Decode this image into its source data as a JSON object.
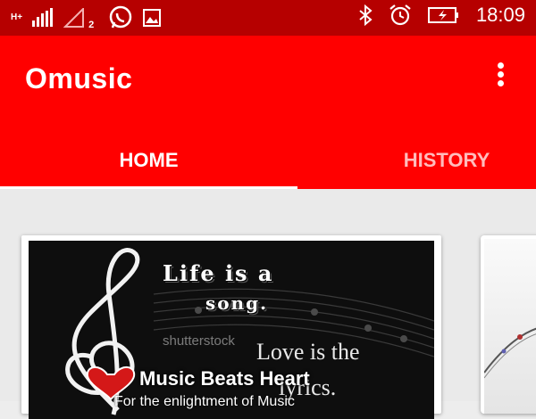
{
  "status_bar": {
    "network_type": "H+",
    "sim2_label": "2",
    "time": "18:09"
  },
  "app_bar": {
    "title": "Omusic"
  },
  "tabs": [
    {
      "label": "HOME",
      "selected": true
    },
    {
      "label": "HISTORY",
      "selected": false
    }
  ],
  "cards": [
    {
      "image_text": {
        "line1": "Life is a",
        "line2": "song.",
        "line3": "Love is the",
        "line4": "lyrics.",
        "watermark": "shutterstock"
      },
      "title": "Music Beats Heart",
      "subtitle": "For the enlightment of Music"
    }
  ],
  "colors": {
    "status_bar": "#b60000",
    "app_bar": "#ff0000",
    "tab_inactive": "#ffbcbc",
    "background": "#eaeaea"
  }
}
